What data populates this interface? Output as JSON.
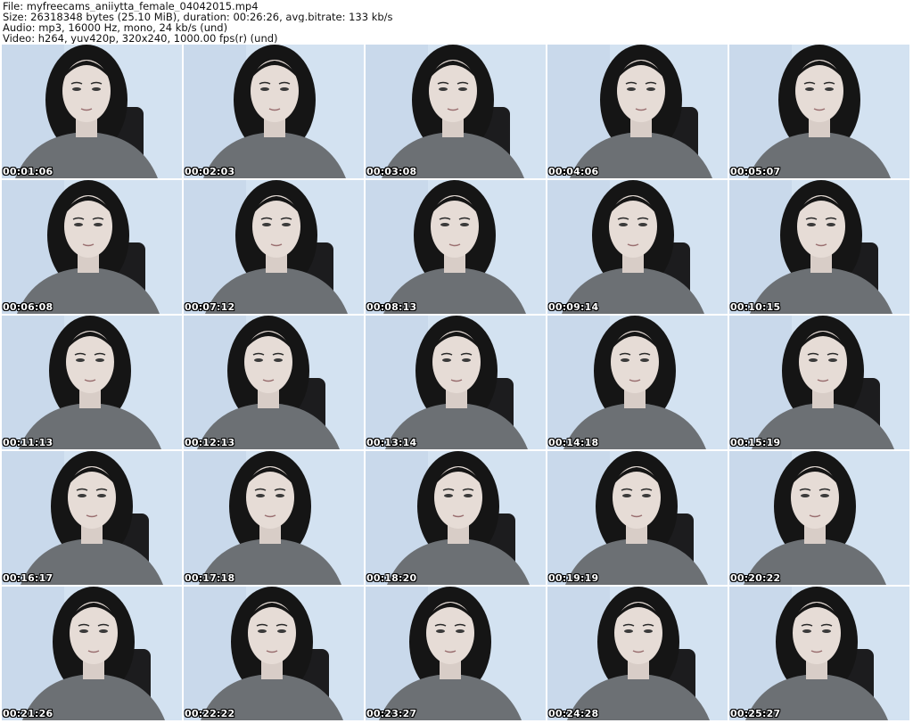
{
  "header": {
    "file_line": "File: myfreecams_aniiytta_female_04042015.mp4",
    "size_line": "Size: 26318348 bytes (25.10 MiB), duration: 00:26:26, avg.bitrate: 133 kb/s",
    "audio_line": "Audio: mp3, 16000 Hz, mono, 24 kb/s (und)",
    "video_line": "Video: h264, yuv420p, 320x240, 1000.00 fps(r) (und)"
  },
  "thumbnails": [
    {
      "timestamp": "00:01:06"
    },
    {
      "timestamp": "00:02:03"
    },
    {
      "timestamp": "00:03:08"
    },
    {
      "timestamp": "00:04:06"
    },
    {
      "timestamp": "00:05:07"
    },
    {
      "timestamp": "00:06:08"
    },
    {
      "timestamp": "00:07:12"
    },
    {
      "timestamp": "00:08:13"
    },
    {
      "timestamp": "00:09:14"
    },
    {
      "timestamp": "00:10:15"
    },
    {
      "timestamp": "00:11:13"
    },
    {
      "timestamp": "00:12:13"
    },
    {
      "timestamp": "00:13:14"
    },
    {
      "timestamp": "00:14:18"
    },
    {
      "timestamp": "00:15:19"
    },
    {
      "timestamp": "00:16:17"
    },
    {
      "timestamp": "00:17:18"
    },
    {
      "timestamp": "00:18:20"
    },
    {
      "timestamp": "00:19:19"
    },
    {
      "timestamp": "00:20:22"
    },
    {
      "timestamp": "00:21:26"
    },
    {
      "timestamp": "00:22:22"
    },
    {
      "timestamp": "00:23:27"
    },
    {
      "timestamp": "00:24:28"
    },
    {
      "timestamp": "00:25:27"
    }
  ],
  "colors": {
    "background": "#ffffff",
    "header_text": "#111111",
    "timestamp_text": "#ffffff",
    "timestamp_outline": "#000000",
    "wall": "#d3e2f1",
    "hair": "#151515",
    "skin": "#e6dcd6",
    "shirt": "#6c7074",
    "chair": "#1c1c1e"
  }
}
